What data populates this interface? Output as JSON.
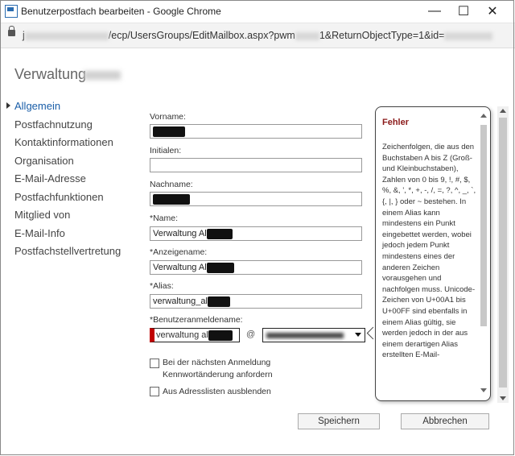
{
  "window": {
    "title": "Benutzerpostfach bearbeiten - Google Chrome",
    "minimize_icon": "minimize-icon",
    "maximize_icon": "maximize-icon",
    "close_icon": "close-icon"
  },
  "address": {
    "prefix": "j",
    "path": "/ecp/UsersGroups/EditMailbox.aspx?pwm",
    "mid": "1&ReturnObjectType=1&id="
  },
  "page": {
    "title": "Verwaltung"
  },
  "nav": {
    "items": [
      {
        "label": "Allgemein"
      },
      {
        "label": "Postfachnutzung"
      },
      {
        "label": "Kontaktinformationen"
      },
      {
        "label": "Organisation"
      },
      {
        "label": "E-Mail-Adresse"
      },
      {
        "label": "Postfachfunktionen"
      },
      {
        "label": "Mitglied von"
      },
      {
        "label": "E-Mail-Info"
      },
      {
        "label": "Postfachstellvertretung"
      }
    ]
  },
  "form": {
    "vorname_label": "Vorname:",
    "initialen_label": "Initialen:",
    "nachname_label": "Nachname:",
    "name_label": "*Name:",
    "name_value": "Verwaltung Al",
    "anzeigename_label": "*Anzeigename:",
    "anzeigename_value": "Verwaltung Al",
    "alias_label": "*Alias:",
    "alias_value": "verwaltung_al",
    "benutzeranmeldename_label": "*Benutzeranmeldename:",
    "benutzeranmeldename_value": "verwaltung al",
    "at_sign": "@",
    "checkbox1_label_line1": "Bei der nächsten Anmeldung",
    "checkbox1_label_line2": "Kennwortänderung anfordern",
    "checkbox2_label": "Aus Adresslisten ausblenden"
  },
  "error_tooltip": {
    "title": "Fehler",
    "body": "Zeichenfolgen, die aus den Buchstaben A bis Z (Groß- und Kleinbuchstaben), Zahlen von 0 bis 9, !, #, $, %, &, ', *, +, -, /, =, ?, ^, _, `, {, |, } oder ~ bestehen. In einem Alias kann mindestens ein Punkt eingebettet werden, wobei jedoch jedem Punkt mindestens eines der anderen Zeichen vorausgehen und nachfolgen muss. Unicode-Zeichen von U+00A1 bis U+00FF sind ebenfalls in einem Alias gültig, sie werden jedoch in der aus einem derartigen Alias erstellten E-Mail-"
  },
  "buttons": {
    "save": "Speichern",
    "cancel": "Abbrechen"
  },
  "colors": {
    "accent": "#1a5ea8",
    "error_title": "#8b1a1a",
    "error_border": "#c00000"
  }
}
